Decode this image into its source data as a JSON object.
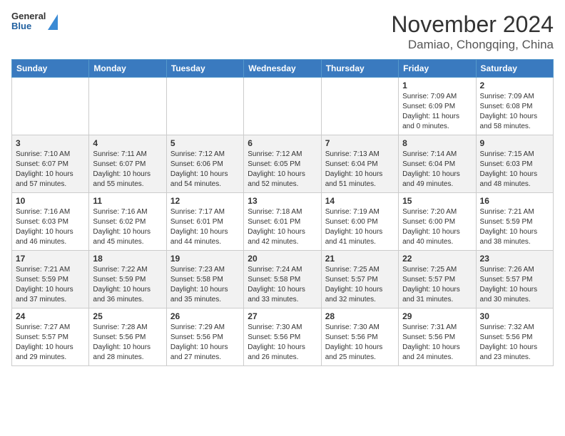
{
  "header": {
    "logo": {
      "general": "General",
      "blue": "Blue"
    },
    "title": "November 2024",
    "subtitle": "Damiao, Chongqing, China"
  },
  "weekdays": [
    "Sunday",
    "Monday",
    "Tuesday",
    "Wednesday",
    "Thursday",
    "Friday",
    "Saturday"
  ],
  "weeks": [
    [
      {
        "day": null
      },
      {
        "day": null
      },
      {
        "day": null
      },
      {
        "day": null
      },
      {
        "day": null
      },
      {
        "day": 1,
        "sunrise": "7:09 AM",
        "sunset": "6:09 PM",
        "daylight": "11 hours and 0 minutes."
      },
      {
        "day": 2,
        "sunrise": "7:09 AM",
        "sunset": "6:08 PM",
        "daylight": "10 hours and 58 minutes."
      }
    ],
    [
      {
        "day": 3,
        "sunrise": "7:10 AM",
        "sunset": "6:07 PM",
        "daylight": "10 hours and 57 minutes."
      },
      {
        "day": 4,
        "sunrise": "7:11 AM",
        "sunset": "6:07 PM",
        "daylight": "10 hours and 55 minutes."
      },
      {
        "day": 5,
        "sunrise": "7:12 AM",
        "sunset": "6:06 PM",
        "daylight": "10 hours and 54 minutes."
      },
      {
        "day": 6,
        "sunrise": "7:12 AM",
        "sunset": "6:05 PM",
        "daylight": "10 hours and 52 minutes."
      },
      {
        "day": 7,
        "sunrise": "7:13 AM",
        "sunset": "6:04 PM",
        "daylight": "10 hours and 51 minutes."
      },
      {
        "day": 8,
        "sunrise": "7:14 AM",
        "sunset": "6:04 PM",
        "daylight": "10 hours and 49 minutes."
      },
      {
        "day": 9,
        "sunrise": "7:15 AM",
        "sunset": "6:03 PM",
        "daylight": "10 hours and 48 minutes."
      }
    ],
    [
      {
        "day": 10,
        "sunrise": "7:16 AM",
        "sunset": "6:03 PM",
        "daylight": "10 hours and 46 minutes."
      },
      {
        "day": 11,
        "sunrise": "7:16 AM",
        "sunset": "6:02 PM",
        "daylight": "10 hours and 45 minutes."
      },
      {
        "day": 12,
        "sunrise": "7:17 AM",
        "sunset": "6:01 PM",
        "daylight": "10 hours and 44 minutes."
      },
      {
        "day": 13,
        "sunrise": "7:18 AM",
        "sunset": "6:01 PM",
        "daylight": "10 hours and 42 minutes."
      },
      {
        "day": 14,
        "sunrise": "7:19 AM",
        "sunset": "6:00 PM",
        "daylight": "10 hours and 41 minutes."
      },
      {
        "day": 15,
        "sunrise": "7:20 AM",
        "sunset": "6:00 PM",
        "daylight": "10 hours and 40 minutes."
      },
      {
        "day": 16,
        "sunrise": "7:21 AM",
        "sunset": "5:59 PM",
        "daylight": "10 hours and 38 minutes."
      }
    ],
    [
      {
        "day": 17,
        "sunrise": "7:21 AM",
        "sunset": "5:59 PM",
        "daylight": "10 hours and 37 minutes."
      },
      {
        "day": 18,
        "sunrise": "7:22 AM",
        "sunset": "5:59 PM",
        "daylight": "10 hours and 36 minutes."
      },
      {
        "day": 19,
        "sunrise": "7:23 AM",
        "sunset": "5:58 PM",
        "daylight": "10 hours and 35 minutes."
      },
      {
        "day": 20,
        "sunrise": "7:24 AM",
        "sunset": "5:58 PM",
        "daylight": "10 hours and 33 minutes."
      },
      {
        "day": 21,
        "sunrise": "7:25 AM",
        "sunset": "5:57 PM",
        "daylight": "10 hours and 32 minutes."
      },
      {
        "day": 22,
        "sunrise": "7:25 AM",
        "sunset": "5:57 PM",
        "daylight": "10 hours and 31 minutes."
      },
      {
        "day": 23,
        "sunrise": "7:26 AM",
        "sunset": "5:57 PM",
        "daylight": "10 hours and 30 minutes."
      }
    ],
    [
      {
        "day": 24,
        "sunrise": "7:27 AM",
        "sunset": "5:57 PM",
        "daylight": "10 hours and 29 minutes."
      },
      {
        "day": 25,
        "sunrise": "7:28 AM",
        "sunset": "5:56 PM",
        "daylight": "10 hours and 28 minutes."
      },
      {
        "day": 26,
        "sunrise": "7:29 AM",
        "sunset": "5:56 PM",
        "daylight": "10 hours and 27 minutes."
      },
      {
        "day": 27,
        "sunrise": "7:30 AM",
        "sunset": "5:56 PM",
        "daylight": "10 hours and 26 minutes."
      },
      {
        "day": 28,
        "sunrise": "7:30 AM",
        "sunset": "5:56 PM",
        "daylight": "10 hours and 25 minutes."
      },
      {
        "day": 29,
        "sunrise": "7:31 AM",
        "sunset": "5:56 PM",
        "daylight": "10 hours and 24 minutes."
      },
      {
        "day": 30,
        "sunrise": "7:32 AM",
        "sunset": "5:56 PM",
        "daylight": "10 hours and 23 minutes."
      }
    ]
  ]
}
